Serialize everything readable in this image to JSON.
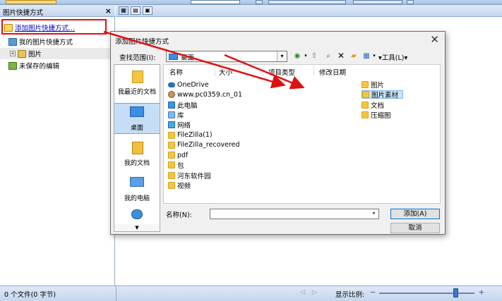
{
  "left_panel": {
    "title": "图片快捷方式",
    "close_label": "×",
    "add_link": "添加图片快捷方式...",
    "my_shortcuts": "我的图片快捷方式",
    "pictures": "图片",
    "unsaved": "未保存的编辑",
    "expander": "+"
  },
  "status": {
    "file_count": "0 个文件(0 字节)",
    "zoom_label": "显示比例:",
    "zoom_minus": "−",
    "zoom_plus": "+",
    "zoom_level": 0.8,
    "nav": "◁▷"
  },
  "dialog": {
    "title": "添加图片快捷方式",
    "close_label": "✕",
    "lookin_label": "查找范围(I):",
    "lookin_value": "桌面",
    "tools_label": "▾工具(L)▾",
    "places": [
      {
        "label": "我最近的文档"
      },
      {
        "label": "桌面"
      },
      {
        "label": "我的文档"
      },
      {
        "label": "我的电脑"
      }
    ],
    "columns": [
      "名称",
      "大小",
      "项目类型",
      "修改日期"
    ],
    "left_items": [
      {
        "label": "OneDrive",
        "icon": "cloud-icon"
      },
      {
        "label": "www.pc0359.cn_01",
        "icon": "user-icon"
      },
      {
        "label": "此电脑",
        "icon": "computer-icon"
      },
      {
        "label": "库",
        "icon": "library-icon"
      },
      {
        "label": "网络",
        "icon": "network-icon"
      },
      {
        "label": "FileZilla(1)",
        "icon": "folder-icon"
      },
      {
        "label": "FileZilla_recovered",
        "icon": "folder-icon"
      },
      {
        "label": "pdf",
        "icon": "folder-icon"
      },
      {
        "label": "包",
        "icon": "folder-icon"
      },
      {
        "label": "河东软件园",
        "icon": "folder-icon"
      },
      {
        "label": "视频",
        "icon": "folder-icon"
      }
    ],
    "right_items": [
      {
        "label": "图片",
        "icon": "folder-icon"
      },
      {
        "label": "图片素材",
        "icon": "folder-icon",
        "selected": true
      },
      {
        "label": "文档",
        "icon": "folder-icon"
      },
      {
        "label": "压缩图",
        "icon": "folder-icon"
      }
    ],
    "name_label": "名称(N):",
    "name_value": "",
    "add_button": "添加(A)",
    "cancel_button": "取消"
  },
  "colors": {
    "highlight": "#e01010",
    "arrow": "#e01010",
    "accent": "#3c78c8"
  }
}
